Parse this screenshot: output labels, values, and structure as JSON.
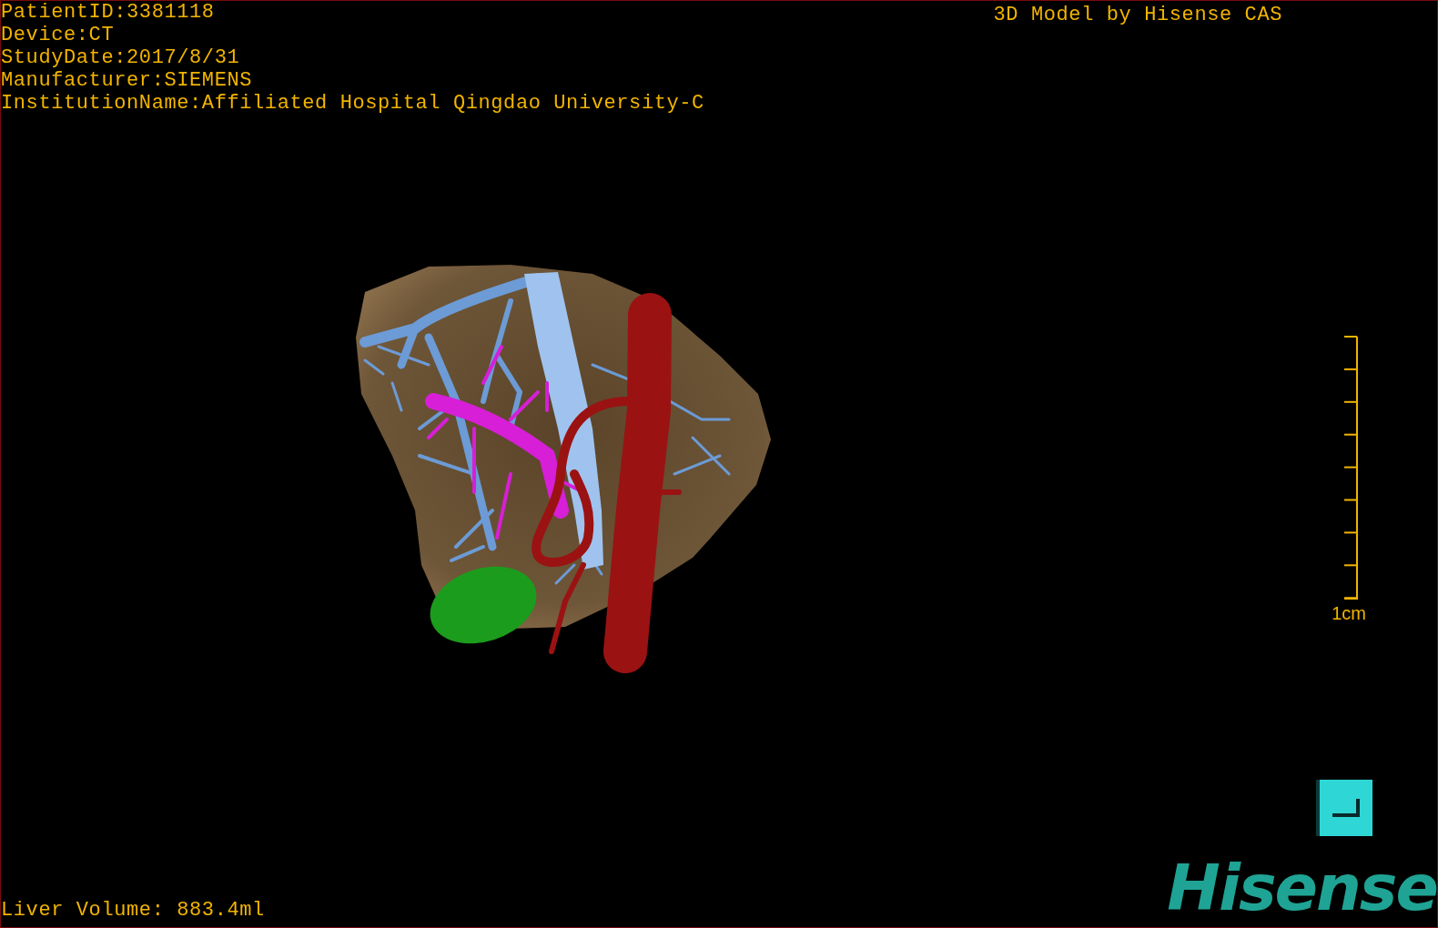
{
  "overlay": {
    "info_lines": [
      "PatientID:3381118",
      "Device:CT",
      "StudyDate:2017/8/31",
      "Manufacturer:SIEMENS",
      "InstitutionName:Affiliated Hospital Qingdao University-C"
    ],
    "title": "3D Model by Hisense CAS",
    "liver_volume": "Liver Volume: 883.4ml"
  },
  "scale_bar": {
    "label": "1cm"
  },
  "logo": {
    "text": "Hisense"
  }
}
